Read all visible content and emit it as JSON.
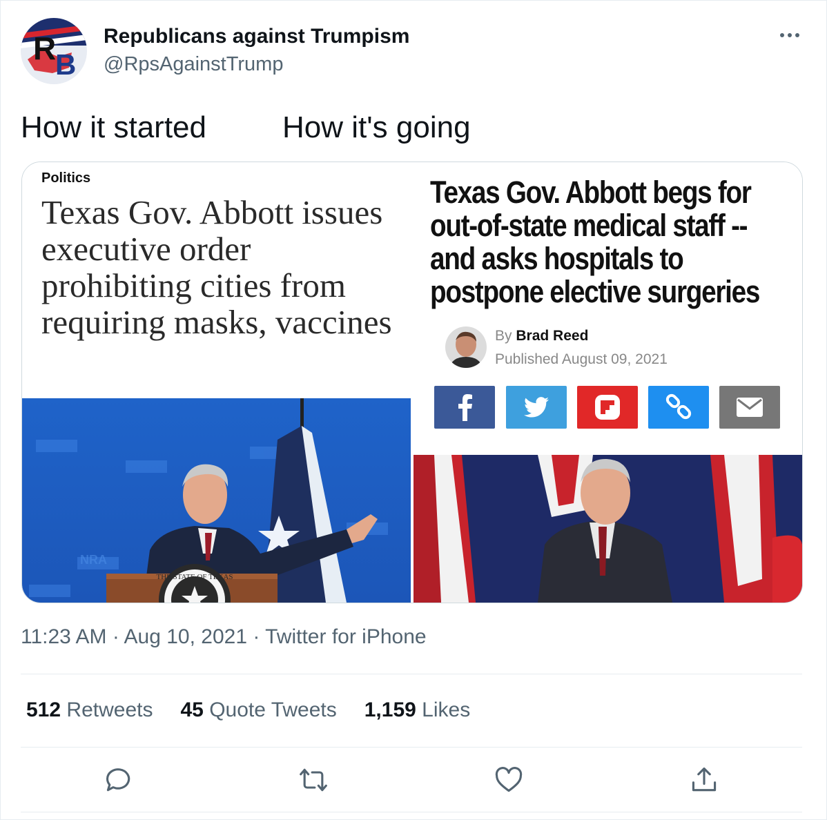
{
  "user": {
    "display_name": "Republicans against Trumpism",
    "handle": "@RpsAgainstTrump",
    "avatar_letters": "RB"
  },
  "tweet": {
    "text": "How it started         How it's going",
    "timestamp": "11:23 AM · Aug 10, 2021 · Twitter for iPhone"
  },
  "media": {
    "left": {
      "section": "Politics",
      "headline": "Texas Gov. Abbott issues executive order prohibiting cities from requiring masks, vaccines",
      "seal_text": "THE STATE OF TEXAS",
      "backdrop_text": "NRA"
    },
    "right": {
      "headline": "Texas Gov. Abbott begs for out-of-state medical staff -- and asks hospitals to postpone elective surgeries",
      "by_label": "By",
      "author": "Brad Reed",
      "published": "Published August 09, 2021",
      "share_buttons": [
        "facebook-icon",
        "twitter-icon",
        "flipboard-icon",
        "link-icon",
        "email-icon"
      ],
      "share_colors": [
        "#3b5998",
        "#3ea0de",
        "#e12828",
        "#1e8ff0",
        "#777777"
      ]
    }
  },
  "stats": {
    "retweets_count": "512",
    "retweets_label": "Retweets",
    "quotes_count": "45",
    "quotes_label": "Quote Tweets",
    "likes_count": "1,159",
    "likes_label": "Likes"
  },
  "actions": [
    "reply-icon",
    "retweet-icon",
    "like-icon",
    "share-icon"
  ]
}
